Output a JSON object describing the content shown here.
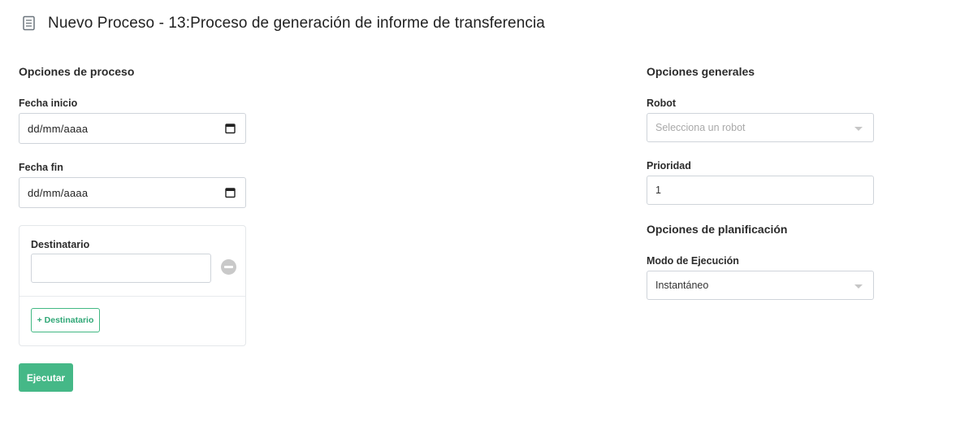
{
  "header": {
    "icon": "document-icon",
    "title": "Nuevo Proceso - 13:Proceso de generación de informe de transferencia"
  },
  "process_options": {
    "title": "Opciones de proceso",
    "start_date": {
      "label": "Fecha inicio",
      "value": "dd/mm/aaaa",
      "icon": "calendar-icon"
    },
    "end_date": {
      "label": "Fecha fin",
      "value": "dd/mm/aaaa",
      "icon": "calendar-icon"
    },
    "recipient": {
      "label": "Destinatario",
      "value": "",
      "remove_icon": "minus-circle-icon",
      "add_button_label": "+ Destinatario"
    }
  },
  "general_options": {
    "title": "Opciones generales",
    "robot": {
      "label": "Robot",
      "placeholder": "Selecciona un robot"
    },
    "priority": {
      "label": "Prioridad",
      "value": "1"
    }
  },
  "planning_options": {
    "title": "Opciones de planificación",
    "execution_mode": {
      "label": "Modo de Ejecución",
      "value": "Instantáneo"
    }
  },
  "actions": {
    "execute_label": "Ejecutar"
  },
  "colors": {
    "accent": "#45b887",
    "border": "#cfd4da",
    "text": "#2b2b2b"
  }
}
